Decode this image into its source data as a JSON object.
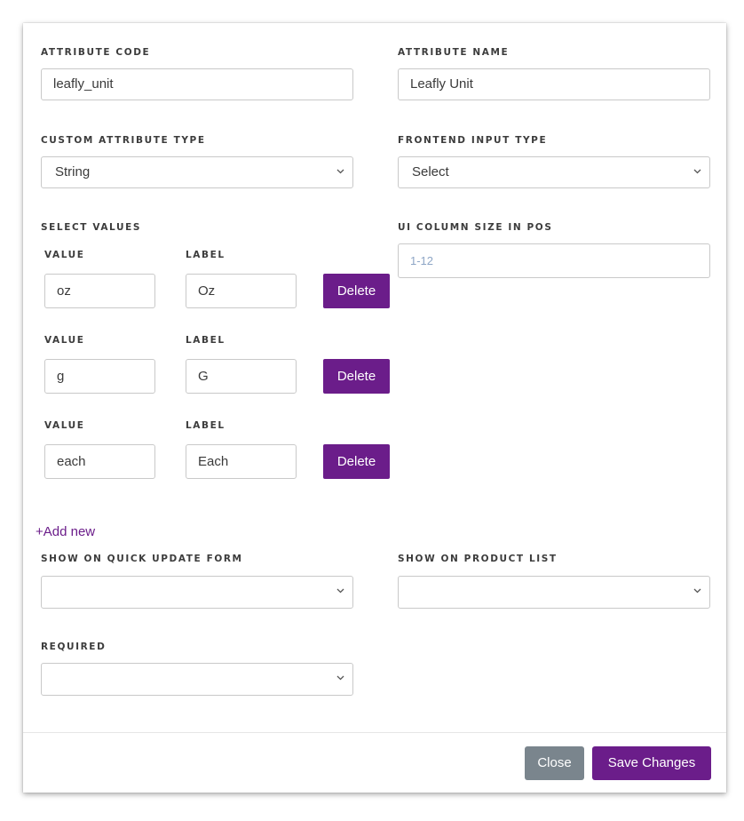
{
  "fields": {
    "attribute_code": {
      "label": "ATTRIBUTE CODE",
      "value": "leafly_unit"
    },
    "attribute_name": {
      "label": "ATTRIBUTE NAME",
      "value": "Leafly Unit"
    },
    "custom_attribute_type": {
      "label": "CUSTOM ATTRIBUTE TYPE",
      "value": "String"
    },
    "frontend_input_type": {
      "label": "FRONTEND INPUT TYPE",
      "value": "Select"
    },
    "ui_column_size": {
      "label": "UI COLUMN SIZE IN POS",
      "placeholder": "1-12"
    },
    "show_on_quick_update": {
      "label": "SHOW ON QUICK UPDATE FORM",
      "value": ""
    },
    "show_on_product_list": {
      "label": "SHOW ON PRODUCT LIST",
      "value": ""
    },
    "required": {
      "label": "REQUIRED",
      "value": ""
    }
  },
  "select_values": {
    "label": "SELECT VALUES",
    "value_header": "VALUE",
    "label_header": "LABEL",
    "delete_label": "Delete",
    "rows": [
      {
        "value": "oz",
        "label": "Oz"
      },
      {
        "value": "g",
        "label": "G"
      },
      {
        "value": "each",
        "label": "Each"
      }
    ],
    "add_new": "+Add new"
  },
  "footer": {
    "close_label": "Close",
    "save_label": "Save Changes"
  },
  "colors": {
    "accent": "#6b1d8a",
    "close_button": "#7a858d"
  }
}
